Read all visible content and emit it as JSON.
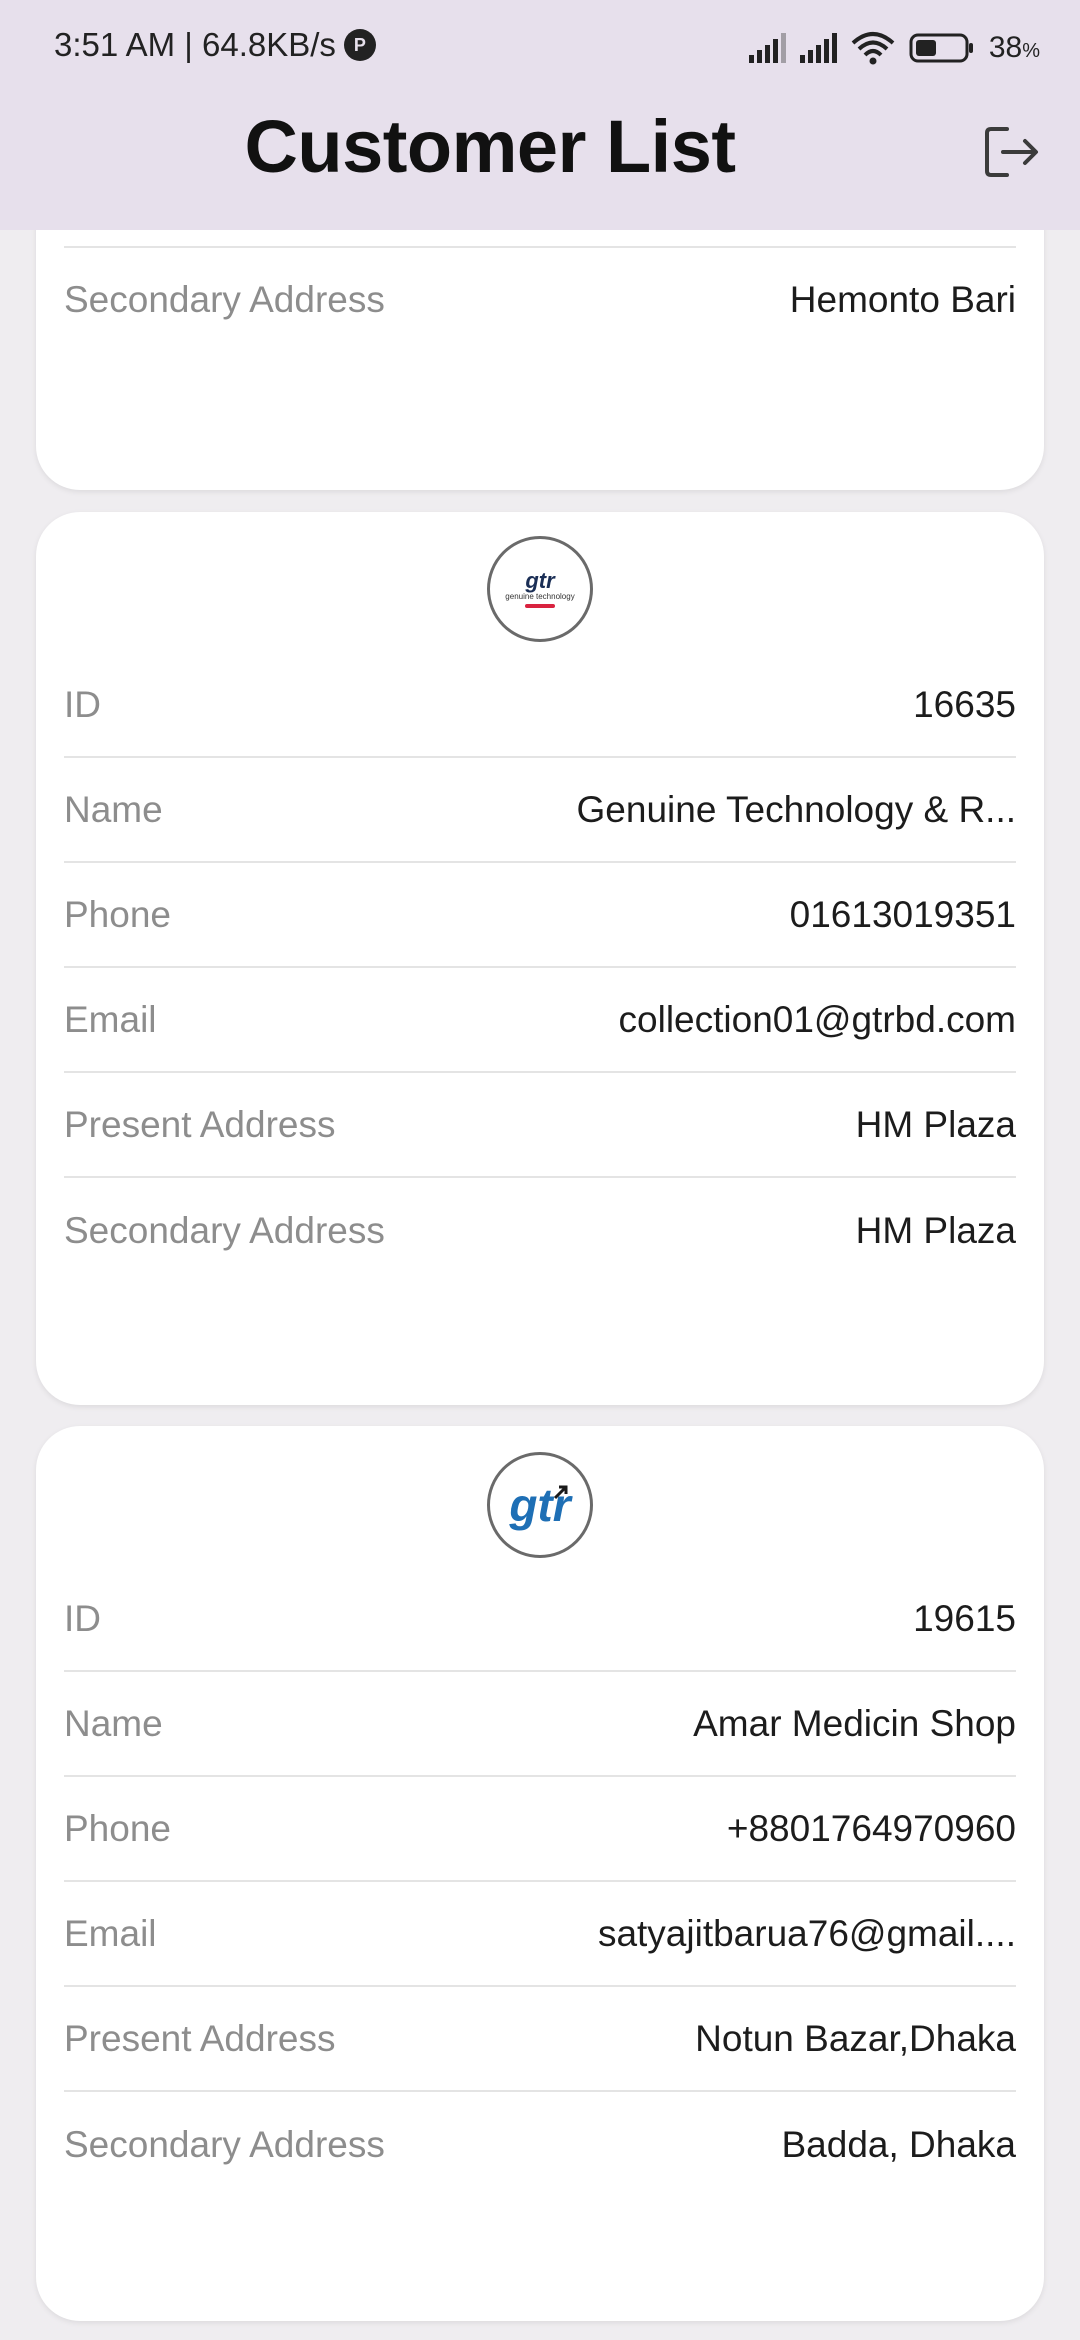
{
  "status_bar": {
    "time_speed": "3:51 AM | 64.8KB/s",
    "battery_percent": "38",
    "battery_unit": "%"
  },
  "header": {
    "title": "Customer List"
  },
  "partial_card": {
    "label": "Secondary Address",
    "value": "Hemonto Bari"
  },
  "customers": [
    {
      "logo_text": "gtr",
      "logo_subtext": "genuine technology",
      "rows": [
        {
          "label": "ID",
          "value": "16635"
        },
        {
          "label": "Name",
          "value": "Genuine Technology & R..."
        },
        {
          "label": "Phone",
          "value": "01613019351"
        },
        {
          "label": "Email",
          "value": "collection01@gtrbd.com"
        },
        {
          "label": "Present Address",
          "value": "HM Plaza"
        },
        {
          "label": "Secondary Address",
          "value": "HM Plaza"
        }
      ]
    },
    {
      "logo_text": "gtr",
      "rows": [
        {
          "label": "ID",
          "value": "19615"
        },
        {
          "label": "Name",
          "value": "Amar Medicin Shop"
        },
        {
          "label": "Phone",
          "value": "+8801764970960"
        },
        {
          "label": "Email",
          "value": "satyajitbarua76@gmail...."
        },
        {
          "label": "Present Address",
          "value": "Notun Bazar,Dhaka"
        },
        {
          "label": "Secondary Address",
          "value": "Badda, Dhaka"
        }
      ]
    }
  ],
  "icons": {
    "logout": "logout-icon",
    "wifi": "wifi-icon",
    "battery": "battery-icon",
    "signal": "signal-icon"
  },
  "colors": {
    "header_bg": "#e7e0ec",
    "page_bg": "#efedf0",
    "card_bg": "#ffffff",
    "label_text": "#8d8d8d",
    "value_text": "#1c1c1c",
    "logo_blue": "#1e6fb5"
  }
}
